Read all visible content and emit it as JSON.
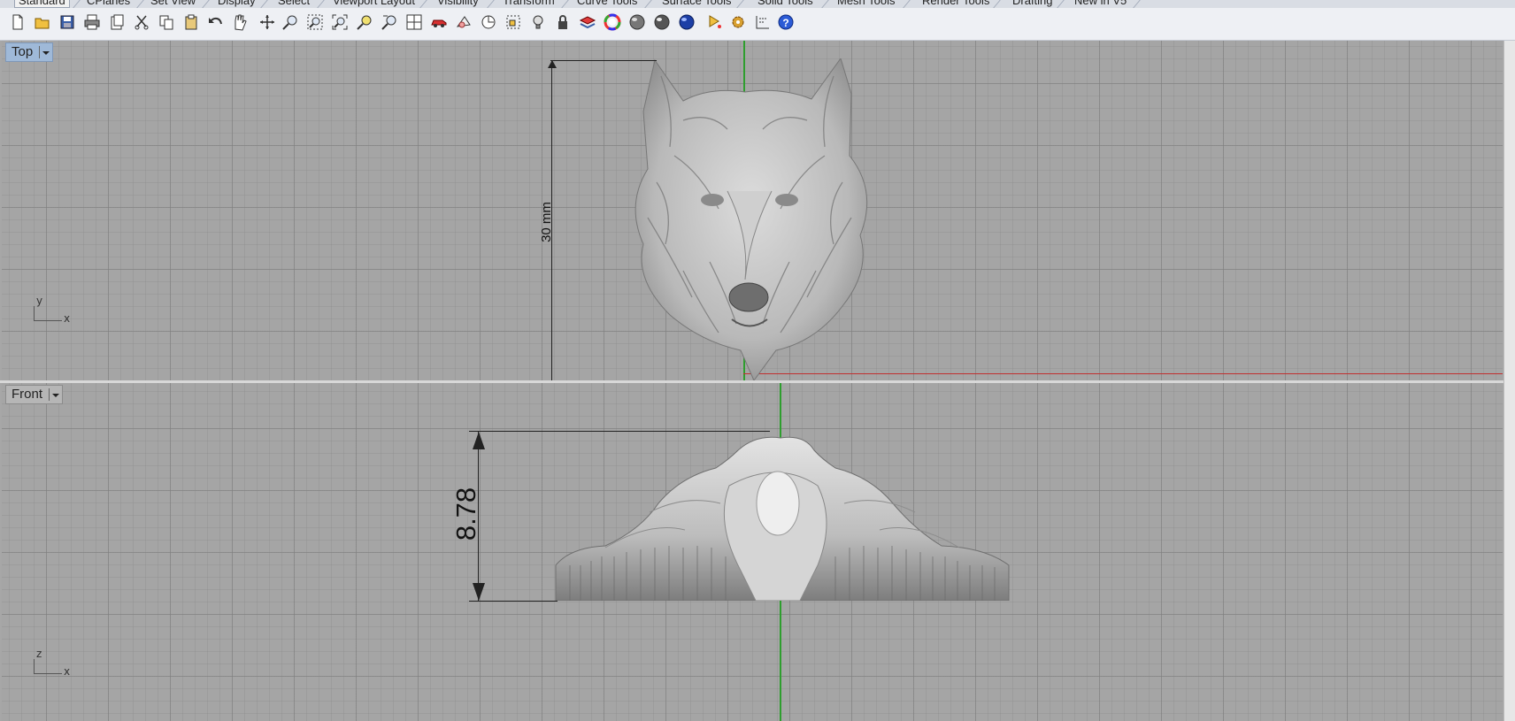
{
  "tabs": [
    {
      "label": "Standard",
      "active": true
    },
    {
      "label": "CPlanes"
    },
    {
      "label": "Set View"
    },
    {
      "label": "Display"
    },
    {
      "label": "Select"
    },
    {
      "label": "Viewport Layout"
    },
    {
      "label": "Visibility"
    },
    {
      "label": "Transform"
    },
    {
      "label": "Curve Tools"
    },
    {
      "label": "Surface Tools"
    },
    {
      "label": "Solid Tools"
    },
    {
      "label": "Mesh Tools"
    },
    {
      "label": "Render Tools"
    },
    {
      "label": "Drafting"
    },
    {
      "label": "New in V5"
    }
  ],
  "toolbar_icons": [
    "new-file-icon",
    "open-file-icon",
    "save-icon",
    "print-icon",
    "import-icon",
    "cut-icon",
    "copy-icon",
    "paste-icon",
    "undo-icon",
    "pan-icon",
    "rotate-view-icon",
    "zoom-window-icon",
    "zoom-dynamic-icon",
    "zoom-extents-icon",
    "zoom-selected-icon",
    "undo-view-icon",
    "four-viewports-icon",
    "car-icon",
    "properties-icon",
    "cplane-icon",
    "select-points-icon",
    "light-icon",
    "lock-icon",
    "layer-icon",
    "color-wheel-icon",
    "shaded-sphere-icon",
    "rendered-sphere-icon",
    "blue-sphere-icon",
    "analyze-icon",
    "options-icon",
    "dimension-icon",
    "help-icon"
  ],
  "viewports": {
    "top": {
      "label": "Top",
      "dimension": "30 mm",
      "axis_x": "x",
      "axis_y": "y"
    },
    "front": {
      "label": "Front",
      "dimension": "8.78",
      "axis_x": "x",
      "axis_y": "z"
    }
  },
  "colors": {
    "grid_bg": "#a5a5a5",
    "x_axis": "#c03030",
    "y_axis": "#2e9e2e",
    "active_label": "#9fb9d8"
  }
}
